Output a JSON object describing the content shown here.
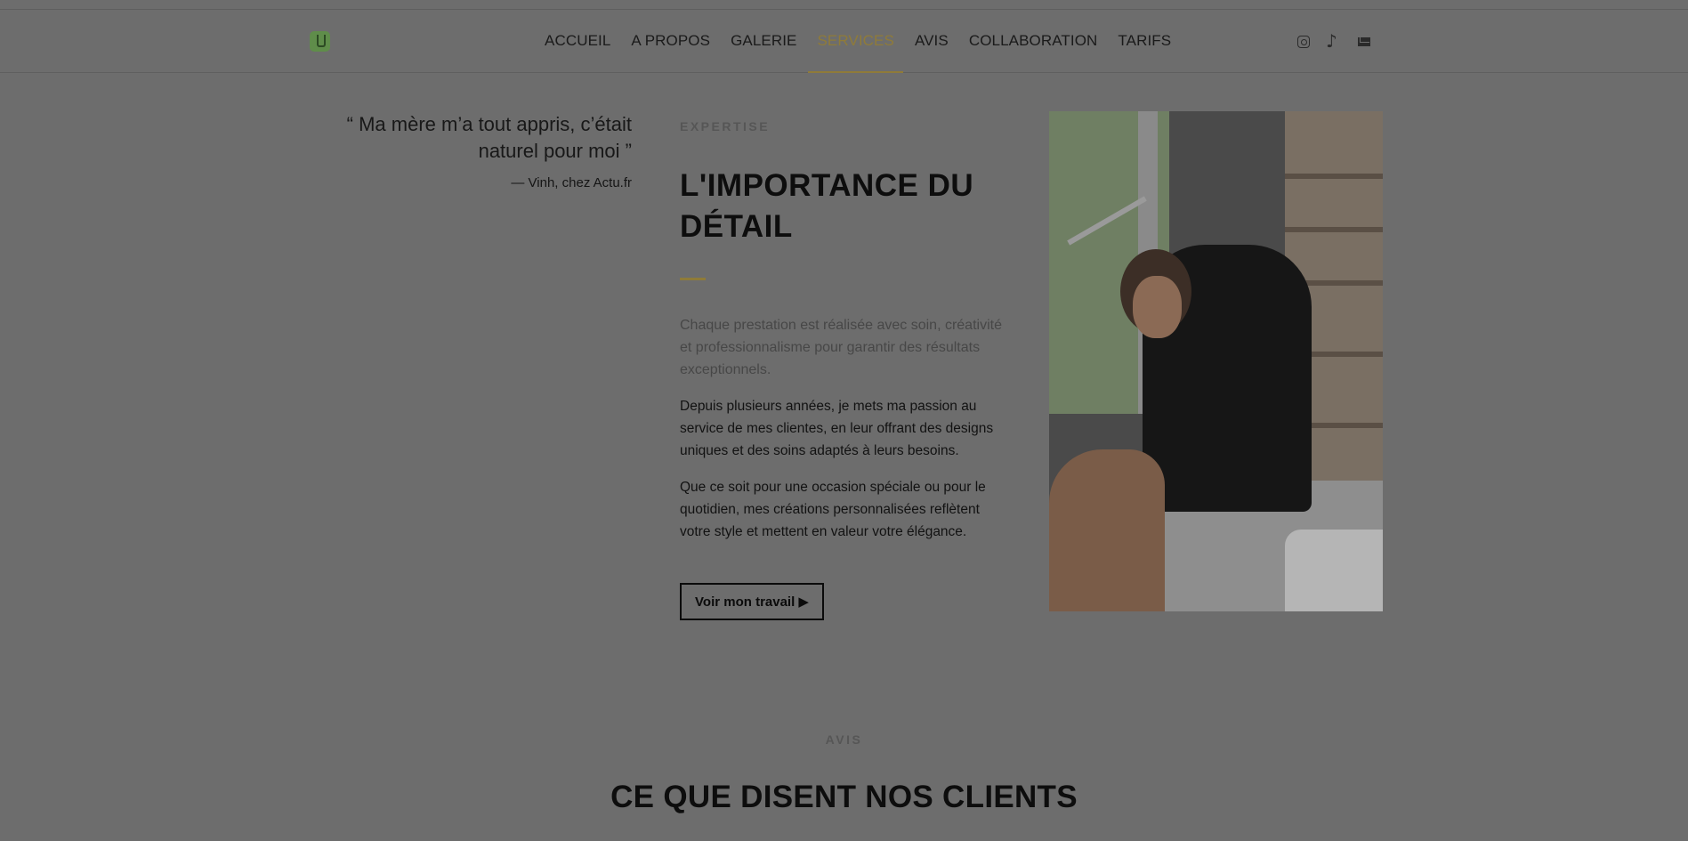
{
  "nav": {
    "items": [
      {
        "label": "ACCUEIL"
      },
      {
        "label": "A PROPOS"
      },
      {
        "label": "GALERIE"
      },
      {
        "label": "SERVICES",
        "active": true
      },
      {
        "label": "AVIS"
      },
      {
        "label": "COLLABORATION"
      },
      {
        "label": "TARIFS"
      }
    ],
    "social": [
      "instagram-icon",
      "tiktok-icon",
      "mail-icon"
    ]
  },
  "quote": {
    "text": "“ Ma mère m’a tout appris, c’était naturel pour moi ”",
    "author": "— Vinh, chez Actu.fr"
  },
  "expertise": {
    "eyebrow": "EXPERTISE",
    "title": "L'IMPORTANCE DU DÉTAIL",
    "lead": "Chaque prestation est réalisée avec soin, créativité et professionnalisme pour garantir des résultats exceptionnels.",
    "paragraph1": "Depuis plusieurs années, je mets ma passion au service de mes clientes, en leur offrant des designs uniques et des soins adaptés à leurs besoins.",
    "paragraph2": "Que ce soit pour une occasion spéciale ou pour le quotidien, mes créations personnalisées reflètent votre style et mettent en valeur votre élégance.",
    "cta": "Voir mon travail ▶"
  },
  "reviews": {
    "eyebrow": "AVIS",
    "title": "CE QUE DISENT NOS CLIENTS"
  },
  "colors": {
    "accent": "#8f7b39",
    "overlay_bg": "#6d6d6d"
  }
}
